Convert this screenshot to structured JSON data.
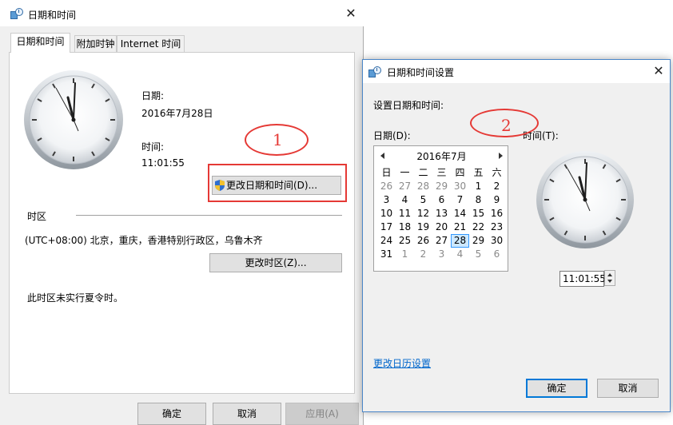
{
  "window1": {
    "title": "日期和时间",
    "tabs": [
      {
        "label": "日期和时间"
      },
      {
        "label": "附加时钟"
      },
      {
        "label": "Internet 时间"
      }
    ],
    "date_label": "日期:",
    "date_value": "2016年7月28日",
    "time_label": "时间:",
    "time_value": "11:01:55",
    "change_datetime_button": "更改日期和时间(D)...",
    "timezone_heading": "时区",
    "timezone_value": "(UTC+08:00) 北京，重庆，香港特别行政区，乌鲁木齐",
    "change_timezone_button": "更改时区(Z)...",
    "dst_note": "此时区未实行夏令时。",
    "ok_button": "确定",
    "cancel_button": "取消",
    "apply_button": "应用(A)"
  },
  "window2": {
    "title": "日期和时间设置",
    "prompt": "设置日期和时间:",
    "date_label": "日期(D):",
    "time_label": "时间(T):",
    "calendar": {
      "month_label": "2016年7月",
      "weekdays": [
        "日",
        "一",
        "二",
        "三",
        "四",
        "五",
        "六"
      ],
      "weeks": [
        [
          "26",
          "27",
          "28",
          "29",
          "30",
          "1",
          "2"
        ],
        [
          "3",
          "4",
          "5",
          "6",
          "7",
          "8",
          "9"
        ],
        [
          "10",
          "11",
          "12",
          "13",
          "14",
          "15",
          "16"
        ],
        [
          "17",
          "18",
          "19",
          "20",
          "21",
          "22",
          "23"
        ],
        [
          "24",
          "25",
          "26",
          "27",
          "28",
          "29",
          "30"
        ],
        [
          "31",
          "1",
          "2",
          "3",
          "4",
          "5",
          "6"
        ]
      ],
      "selected": "28"
    },
    "time_value": "11:01:55",
    "calendar_settings_link": "更改日历设置",
    "ok_button": "确定",
    "cancel_button": "取消"
  },
  "annotations": [
    {
      "label": "1"
    },
    {
      "label": "2"
    }
  ],
  "colors": {
    "annotation": "#e53935",
    "link": "#0066cc",
    "selection": "#cce8ff",
    "dialog_border": "#4a86c8"
  }
}
